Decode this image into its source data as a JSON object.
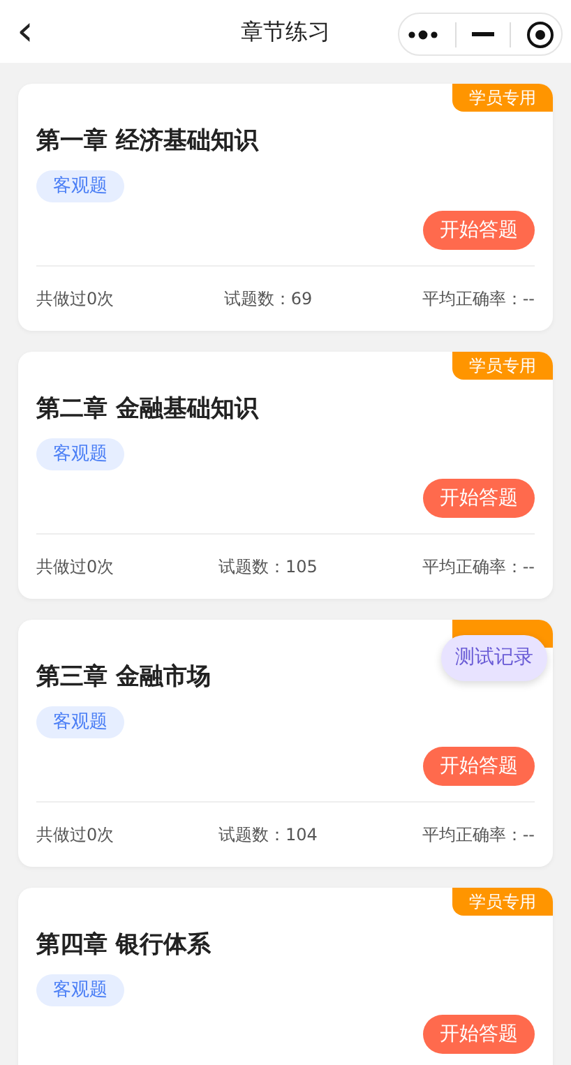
{
  "header": {
    "back": "‹",
    "title": "章节练习"
  },
  "chapters": [
    {
      "member_badge": true,
      "badge": "学员专用",
      "title": "第一章 经济基础知识",
      "tag": "客观题",
      "button": "开始答题",
      "footer": {
        "done": "共做过0次",
        "count": "试题数：69",
        "accuracy": "平均正确率：--"
      }
    },
    {
      "member_badge": true,
      "badge": "学员专用",
      "title": "第二章 金融基础知识",
      "tag": "客观题",
      "button": "开始答题",
      "footer": {
        "done": "共做过0次",
        "count": "试题数：105",
        "accuracy": "平均正确率：--"
      }
    },
    {
      "member_badge": true,
      "title": "第三章 金融市场",
      "tag": "客观题",
      "button": "开始答题",
      "footer": {
        "done": "共做过0次",
        "count": "试题数：104",
        "accuracy": "平均正确率：--"
      }
    },
    {
      "member_badge": true,
      "badge": "学员专用",
      "title": "第四章 银行体系",
      "tag": "客观题",
      "button": "开始答题"
    }
  ],
  "floating_button": "测试记录"
}
